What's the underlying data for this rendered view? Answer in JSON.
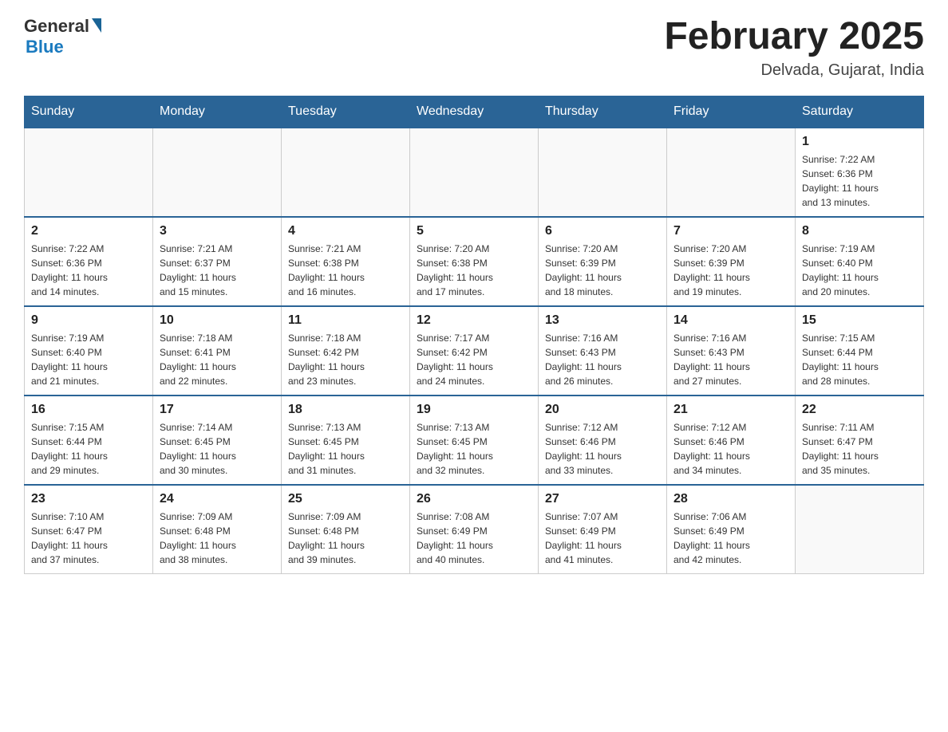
{
  "header": {
    "logo_general": "General",
    "logo_blue": "Blue",
    "month_title": "February 2025",
    "location": "Delvada, Gujarat, India"
  },
  "weekdays": [
    "Sunday",
    "Monday",
    "Tuesday",
    "Wednesday",
    "Thursday",
    "Friday",
    "Saturday"
  ],
  "weeks": [
    [
      {
        "day": "",
        "info": ""
      },
      {
        "day": "",
        "info": ""
      },
      {
        "day": "",
        "info": ""
      },
      {
        "day": "",
        "info": ""
      },
      {
        "day": "",
        "info": ""
      },
      {
        "day": "",
        "info": ""
      },
      {
        "day": "1",
        "info": "Sunrise: 7:22 AM\nSunset: 6:36 PM\nDaylight: 11 hours\nand 13 minutes."
      }
    ],
    [
      {
        "day": "2",
        "info": "Sunrise: 7:22 AM\nSunset: 6:36 PM\nDaylight: 11 hours\nand 14 minutes."
      },
      {
        "day": "3",
        "info": "Sunrise: 7:21 AM\nSunset: 6:37 PM\nDaylight: 11 hours\nand 15 minutes."
      },
      {
        "day": "4",
        "info": "Sunrise: 7:21 AM\nSunset: 6:38 PM\nDaylight: 11 hours\nand 16 minutes."
      },
      {
        "day": "5",
        "info": "Sunrise: 7:20 AM\nSunset: 6:38 PM\nDaylight: 11 hours\nand 17 minutes."
      },
      {
        "day": "6",
        "info": "Sunrise: 7:20 AM\nSunset: 6:39 PM\nDaylight: 11 hours\nand 18 minutes."
      },
      {
        "day": "7",
        "info": "Sunrise: 7:20 AM\nSunset: 6:39 PM\nDaylight: 11 hours\nand 19 minutes."
      },
      {
        "day": "8",
        "info": "Sunrise: 7:19 AM\nSunset: 6:40 PM\nDaylight: 11 hours\nand 20 minutes."
      }
    ],
    [
      {
        "day": "9",
        "info": "Sunrise: 7:19 AM\nSunset: 6:40 PM\nDaylight: 11 hours\nand 21 minutes."
      },
      {
        "day": "10",
        "info": "Sunrise: 7:18 AM\nSunset: 6:41 PM\nDaylight: 11 hours\nand 22 minutes."
      },
      {
        "day": "11",
        "info": "Sunrise: 7:18 AM\nSunset: 6:42 PM\nDaylight: 11 hours\nand 23 minutes."
      },
      {
        "day": "12",
        "info": "Sunrise: 7:17 AM\nSunset: 6:42 PM\nDaylight: 11 hours\nand 24 minutes."
      },
      {
        "day": "13",
        "info": "Sunrise: 7:16 AM\nSunset: 6:43 PM\nDaylight: 11 hours\nand 26 minutes."
      },
      {
        "day": "14",
        "info": "Sunrise: 7:16 AM\nSunset: 6:43 PM\nDaylight: 11 hours\nand 27 minutes."
      },
      {
        "day": "15",
        "info": "Sunrise: 7:15 AM\nSunset: 6:44 PM\nDaylight: 11 hours\nand 28 minutes."
      }
    ],
    [
      {
        "day": "16",
        "info": "Sunrise: 7:15 AM\nSunset: 6:44 PM\nDaylight: 11 hours\nand 29 minutes."
      },
      {
        "day": "17",
        "info": "Sunrise: 7:14 AM\nSunset: 6:45 PM\nDaylight: 11 hours\nand 30 minutes."
      },
      {
        "day": "18",
        "info": "Sunrise: 7:13 AM\nSunset: 6:45 PM\nDaylight: 11 hours\nand 31 minutes."
      },
      {
        "day": "19",
        "info": "Sunrise: 7:13 AM\nSunset: 6:45 PM\nDaylight: 11 hours\nand 32 minutes."
      },
      {
        "day": "20",
        "info": "Sunrise: 7:12 AM\nSunset: 6:46 PM\nDaylight: 11 hours\nand 33 minutes."
      },
      {
        "day": "21",
        "info": "Sunrise: 7:12 AM\nSunset: 6:46 PM\nDaylight: 11 hours\nand 34 minutes."
      },
      {
        "day": "22",
        "info": "Sunrise: 7:11 AM\nSunset: 6:47 PM\nDaylight: 11 hours\nand 35 minutes."
      }
    ],
    [
      {
        "day": "23",
        "info": "Sunrise: 7:10 AM\nSunset: 6:47 PM\nDaylight: 11 hours\nand 37 minutes."
      },
      {
        "day": "24",
        "info": "Sunrise: 7:09 AM\nSunset: 6:48 PM\nDaylight: 11 hours\nand 38 minutes."
      },
      {
        "day": "25",
        "info": "Sunrise: 7:09 AM\nSunset: 6:48 PM\nDaylight: 11 hours\nand 39 minutes."
      },
      {
        "day": "26",
        "info": "Sunrise: 7:08 AM\nSunset: 6:49 PM\nDaylight: 11 hours\nand 40 minutes."
      },
      {
        "day": "27",
        "info": "Sunrise: 7:07 AM\nSunset: 6:49 PM\nDaylight: 11 hours\nand 41 minutes."
      },
      {
        "day": "28",
        "info": "Sunrise: 7:06 AM\nSunset: 6:49 PM\nDaylight: 11 hours\nand 42 minutes."
      },
      {
        "day": "",
        "info": ""
      }
    ]
  ]
}
